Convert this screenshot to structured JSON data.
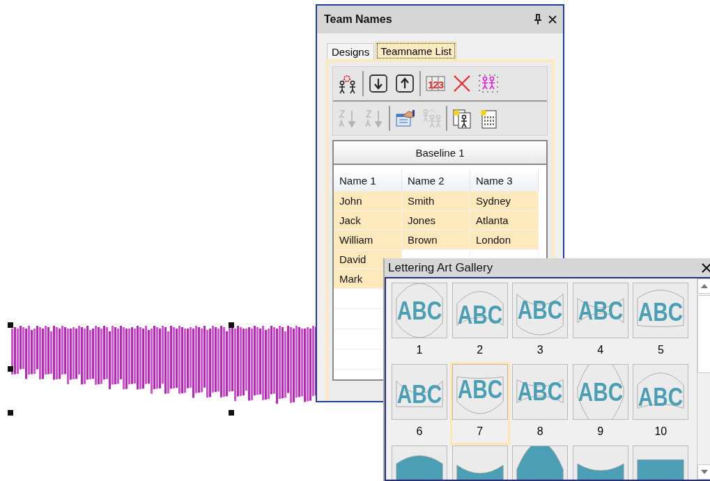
{
  "team_names_panel": {
    "title": "Team Names",
    "tabs": [
      {
        "label": "Designs",
        "selected": false
      },
      {
        "label": "Teamname List",
        "selected": true
      }
    ],
    "toolbar_rows": [
      [
        {
          "kind": "button",
          "disabled": false
        },
        {
          "kind": "separator"
        },
        {
          "kind": "button",
          "disabled": false
        },
        {
          "kind": "button",
          "disabled": false
        },
        {
          "kind": "separator"
        },
        {
          "kind": "button",
          "disabled": false,
          "text": "123"
        },
        {
          "kind": "button",
          "disabled": false
        },
        {
          "kind": "button",
          "disabled": false
        }
      ],
      [
        {
          "kind": "button",
          "disabled": true
        },
        {
          "kind": "button",
          "disabled": true
        },
        {
          "kind": "separator"
        },
        {
          "kind": "button",
          "disabled": false
        },
        {
          "kind": "button",
          "disabled": true
        },
        {
          "kind": "separator"
        },
        {
          "kind": "button",
          "disabled": false
        },
        {
          "kind": "button",
          "disabled": false
        }
      ]
    ],
    "grid": {
      "baseline": "Baseline 1",
      "columns": [
        "Name 1",
        "Name 2",
        "Name 3"
      ],
      "rows": [
        {
          "cells": [
            "John",
            "Smith",
            "Sydney"
          ],
          "selected": true
        },
        {
          "cells": [
            "Jack",
            "Jones",
            "Atlanta"
          ],
          "selected": true
        },
        {
          "cells": [
            "William",
            "Brown",
            "London"
          ],
          "selected": true
        },
        {
          "cells": [
            "David"
          ],
          "selected": true
        },
        {
          "cells": [
            "Mark"
          ],
          "selected": true
        }
      ]
    }
  },
  "lettering_art_gallery": {
    "title": "Lettering Art Gallery",
    "items": [
      {
        "preview": "ABC",
        "number": "1",
        "selected": false
      },
      {
        "preview": "ABC",
        "number": "2",
        "selected": false
      },
      {
        "preview": "ABC",
        "number": "3",
        "selected": false
      },
      {
        "preview": "ABC",
        "number": "4",
        "selected": false
      },
      {
        "preview": "ABC",
        "number": "5",
        "selected": false
      },
      {
        "preview": "ABC",
        "number": "6",
        "selected": false
      },
      {
        "preview": "ABC",
        "number": "7",
        "selected": true
      },
      {
        "preview": "ABC",
        "number": "8",
        "selected": false
      },
      {
        "preview": "ABC",
        "number": "9",
        "selected": false
      },
      {
        "preview": "ABC",
        "number": "10",
        "selected": false
      },
      {
        "selected": false
      },
      {
        "selected": false
      },
      {
        "selected": false
      },
      {
        "selected": false
      },
      {
        "selected": false
      }
    ]
  }
}
